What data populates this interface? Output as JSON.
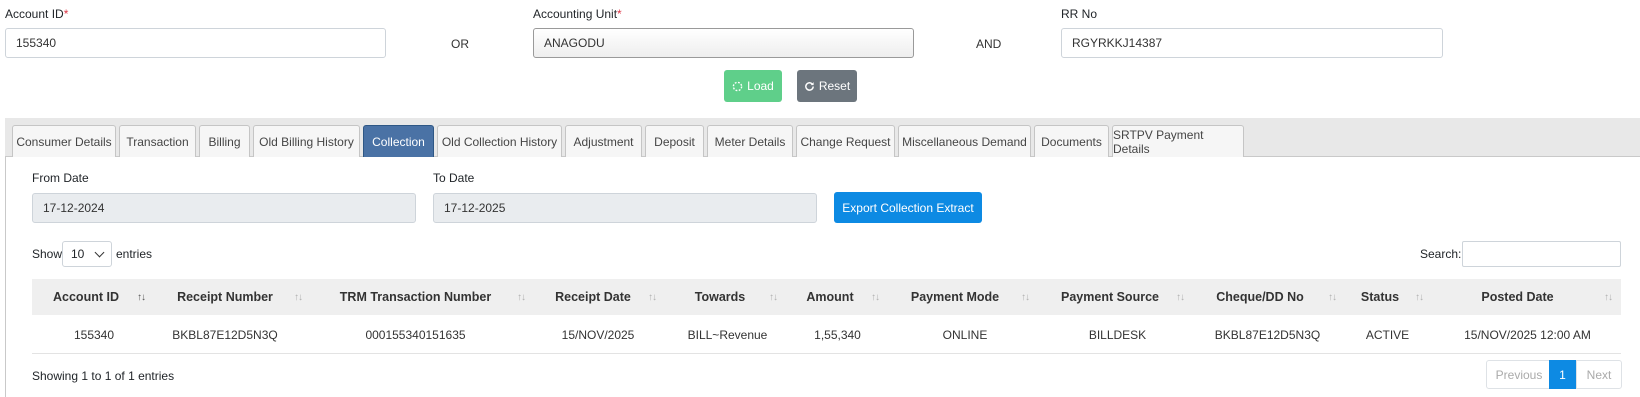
{
  "form": {
    "account_id_label": "Account ID",
    "account_id_value": "155340",
    "accounting_unit_label": "Accounting Unit",
    "accounting_unit_value": "ANAGODU",
    "rr_label": "RR No",
    "rr_value": "RGYRKKJ14387",
    "required_mark": "*",
    "or_text": "OR",
    "and_text": "AND",
    "load_label": "Load",
    "reset_label": "Reset"
  },
  "tabs": [
    {
      "label": "Consumer Details"
    },
    {
      "label": "Transaction"
    },
    {
      "label": "Billing"
    },
    {
      "label": "Old Billing History"
    },
    {
      "label": "Collection"
    },
    {
      "label": "Old Collection History"
    },
    {
      "label": "Adjustment"
    },
    {
      "label": "Deposit"
    },
    {
      "label": "Meter Details"
    },
    {
      "label": "Change Request"
    },
    {
      "label": "Miscellaneous Demand"
    },
    {
      "label": "Documents"
    },
    {
      "label": "SRTPV Payment Details"
    }
  ],
  "active_tab": "Collection",
  "collection": {
    "from_label": "From Date",
    "from_value": "17-12-2024",
    "to_label": "To Date",
    "to_value": "17-12-2025",
    "export_label": "Export Collection Extract",
    "show_label": "Show",
    "entries_label": "entries",
    "page_size": "10",
    "search_label": "Search:",
    "columns": [
      "Account ID",
      "Receipt Number",
      "TRM Transaction Number",
      "Receipt Date",
      "Towards",
      "Amount",
      "Payment Mode",
      "Payment Source",
      "Cheque/DD No",
      "Status",
      "Posted Date"
    ],
    "rows": [
      [
        "155340",
        "BKBL87E12D5N3Q",
        "000155340151635",
        "15/NOV/2025",
        "BILL~Revenue",
        "1,55,340",
        "ONLINE",
        "BILLDESK",
        "BKBL87E12D5N3Q",
        "ACTIVE",
        "15/NOV/2025 12:00 AM"
      ]
    ],
    "info": "Showing 1 to 1 of 1 entries",
    "prev_label": "Previous",
    "current_page": "1",
    "next_label": "Next"
  },
  "colors": {
    "load": "#5fcf8a",
    "reset": "#6c757d",
    "active_tab": "#4a72a5",
    "primary": "#0d8ae3",
    "required": "#dc3545"
  }
}
